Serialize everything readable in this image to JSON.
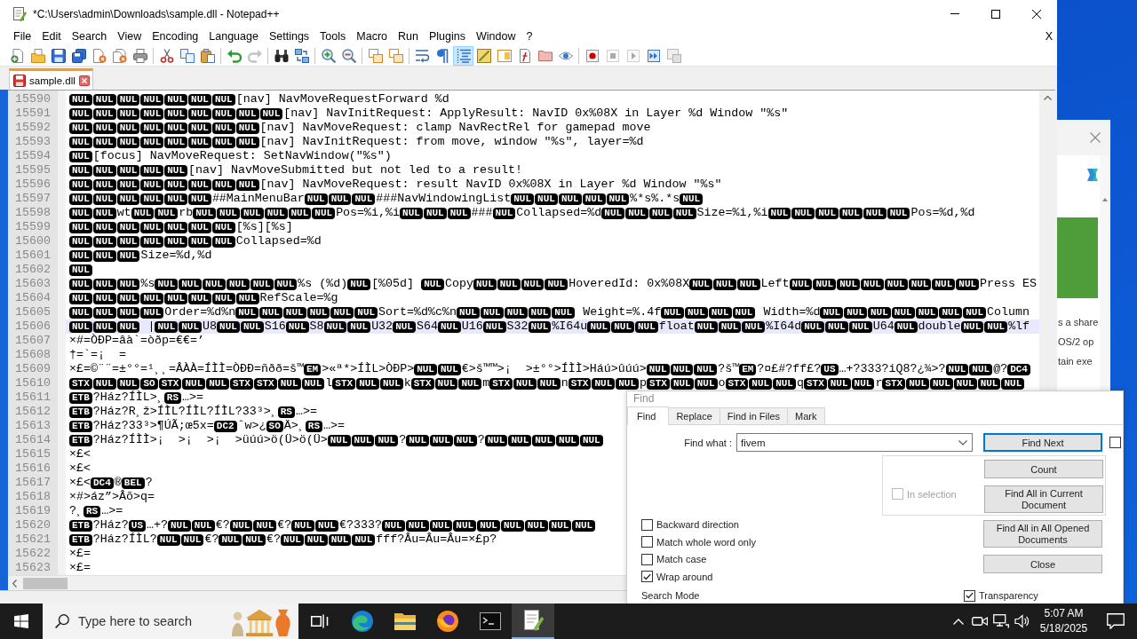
{
  "window": {
    "title": "*C:\\Users\\admin\\Downloads\\sample.dll - Notepad++"
  },
  "menu": {
    "items": [
      "File",
      "Edit",
      "Search",
      "View",
      "Encoding",
      "Language",
      "Settings",
      "Tools",
      "Macro",
      "Run",
      "Plugins",
      "Window",
      "?"
    ],
    "close_label": "X"
  },
  "toolbar": [
    [
      {
        "on": false,
        "disabled": false
      },
      {
        "on": false,
        "disabled": false
      },
      {
        "on": false,
        "disabled": false
      },
      {
        "on": false,
        "disabled": false
      },
      {
        "on": false,
        "disabled": false
      },
      {
        "on": false,
        "disabled": false
      },
      {
        "on": false,
        "disabled": false
      }
    ],
    [
      {
        "on": false,
        "disabled": false
      },
      {
        "on": false,
        "disabled": false
      },
      {
        "on": false,
        "disabled": false
      }
    ],
    [
      {
        "on": false,
        "disabled": false
      },
      {
        "on": false,
        "disabled": true
      }
    ],
    [
      {
        "on": false,
        "disabled": false
      },
      {
        "on": false,
        "disabled": false
      }
    ],
    [
      {
        "on": false,
        "disabled": false
      },
      {
        "on": false,
        "disabled": false
      }
    ],
    [
      {
        "on": false,
        "disabled": false
      },
      {
        "on": false,
        "disabled": false
      }
    ],
    [
      {
        "on": false,
        "disabled": false
      },
      {
        "on": false,
        "disabled": false
      },
      {
        "on": true,
        "disabled": false
      },
      {
        "on": false,
        "disabled": false
      },
      {
        "on": false,
        "disabled": false
      },
      {
        "on": false,
        "disabled": false
      },
      {
        "on": false,
        "disabled": false
      },
      {
        "on": false,
        "disabled": false
      }
    ],
    [
      {
        "on": false,
        "disabled": false
      },
      {
        "on": false,
        "disabled": true
      },
      {
        "on": false,
        "disabled": true
      },
      {
        "on": false,
        "disabled": false
      },
      {
        "on": false,
        "disabled": true
      }
    ]
  ],
  "tabs": [
    {
      "label": "sample.dll",
      "selected": true,
      "modified": true
    }
  ],
  "editor": {
    "lines": [
      {
        "number": "15590",
        "current": false,
        "parts": [
          {
            "kind": "ctrl",
            "codes": [
              "NUL",
              "NUL",
              "NUL",
              "NUL",
              "NUL",
              "NUL",
              "NUL"
            ]
          },
          {
            "kind": "text",
            "text": "[nav] NavMoveRequestForward %d"
          }
        ]
      },
      {
        "number": "15591",
        "current": false,
        "parts": [
          {
            "kind": "ctrl",
            "codes": [
              "NUL",
              "NUL",
              "NUL",
              "NUL",
              "NUL",
              "NUL",
              "NUL",
              "NUL",
              "NUL"
            ]
          },
          {
            "kind": "text",
            "text": "[nav] NavInitRequest: ApplyResult: NavID 0x%08X in Layer %d Window \"%s\""
          }
        ]
      },
      {
        "number": "15592",
        "current": false,
        "parts": [
          {
            "kind": "ctrl",
            "codes": [
              "NUL",
              "NUL",
              "NUL",
              "NUL",
              "NUL",
              "NUL",
              "NUL",
              "NUL"
            ]
          },
          {
            "kind": "text",
            "text": "[nav] NavMoveRequest: clamp NavRectRel for gamepad move"
          }
        ]
      },
      {
        "number": "15593",
        "current": false,
        "parts": [
          {
            "kind": "ctrl",
            "codes": [
              "NUL",
              "NUL",
              "NUL",
              "NUL",
              "NUL",
              "NUL",
              "NUL",
              "NUL"
            ]
          },
          {
            "kind": "text",
            "text": "[nav] NavInitRequest: from move, window \"%s\", layer=%d"
          }
        ]
      },
      {
        "number": "15594",
        "current": false,
        "parts": [
          {
            "kind": "ctrl",
            "codes": [
              "NUL"
            ]
          },
          {
            "kind": "text",
            "text": "[focus] NavMoveRequest: SetNavWindow(\"%s\")"
          }
        ]
      },
      {
        "number": "15595",
        "current": false,
        "parts": [
          {
            "kind": "ctrl",
            "codes": [
              "NUL",
              "NUL",
              "NUL",
              "NUL",
              "NUL"
            ]
          },
          {
            "kind": "text",
            "text": "[nav] NavMoveSubmitted but not led to a result!"
          }
        ]
      },
      {
        "number": "15596",
        "current": false,
        "parts": [
          {
            "kind": "ctrl",
            "codes": [
              "NUL",
              "NUL",
              "NUL",
              "NUL",
              "NUL",
              "NUL",
              "NUL",
              "NUL"
            ]
          },
          {
            "kind": "text",
            "text": "[nav] NavMoveRequest: result NavID 0x%08X in Layer %d Window \"%s\""
          }
        ]
      },
      {
        "number": "15597",
        "current": false,
        "parts": [
          {
            "kind": "ctrl",
            "codes": [
              "NUL",
              "NUL",
              "NUL",
              "NUL",
              "NUL",
              "NUL"
            ]
          },
          {
            "kind": "text",
            "text": "##MainMenuBar"
          },
          {
            "kind": "ctrl",
            "codes": [
              "NUL",
              "NUL",
              "NUL"
            ]
          },
          {
            "kind": "text",
            "text": "###NavWindowingList"
          },
          {
            "kind": "ctrl",
            "codes": [
              "NUL",
              "NUL",
              "NUL",
              "NUL",
              "NUL"
            ]
          },
          {
            "kind": "text",
            "text": "%*s%.*s"
          },
          {
            "kind": "ctrl",
            "codes": [
              "NUL"
            ]
          }
        ]
      },
      {
        "number": "15598",
        "current": false,
        "parts": [
          {
            "kind": "ctrl",
            "codes": [
              "NUL",
              "NUL"
            ]
          },
          {
            "kind": "text",
            "text": "wt"
          },
          {
            "kind": "ctrl",
            "codes": [
              "NUL",
              "NUL"
            ]
          },
          {
            "kind": "text",
            "text": "rb"
          },
          {
            "kind": "ctrl",
            "codes": [
              "NUL",
              "NUL",
              "NUL",
              "NUL",
              "NUL",
              "NUL"
            ]
          },
          {
            "kind": "text",
            "text": "Pos=%i,%i"
          },
          {
            "kind": "ctrl",
            "codes": [
              "NUL",
              "NUL",
              "NUL"
            ]
          },
          {
            "kind": "text",
            "text": "###"
          },
          {
            "kind": "ctrl",
            "codes": [
              "NUL"
            ]
          },
          {
            "kind": "text",
            "text": "Collapsed=%d"
          },
          {
            "kind": "ctrl",
            "codes": [
              "NUL",
              "NUL",
              "NUL",
              "NUL"
            ]
          },
          {
            "kind": "text",
            "text": "Size=%i,%i"
          },
          {
            "kind": "ctrl",
            "codes": [
              "NUL",
              "NUL",
              "NUL",
              "NUL",
              "NUL",
              "NUL"
            ]
          },
          {
            "kind": "text",
            "text": "Pos=%d,%d"
          }
        ]
      },
      {
        "number": "15599",
        "current": false,
        "parts": [
          {
            "kind": "ctrl",
            "codes": [
              "NUL",
              "NUL",
              "NUL",
              "NUL",
              "NUL",
              "NUL",
              "NUL"
            ]
          },
          {
            "kind": "text",
            "text": "[%s][%s]"
          }
        ]
      },
      {
        "number": "15600",
        "current": false,
        "parts": [
          {
            "kind": "ctrl",
            "codes": [
              "NUL",
              "NUL",
              "NUL",
              "NUL",
              "NUL",
              "NUL",
              "NUL"
            ]
          },
          {
            "kind": "text",
            "text": "Collapsed=%d"
          }
        ]
      },
      {
        "number": "15601",
        "current": false,
        "parts": [
          {
            "kind": "ctrl",
            "codes": [
              "NUL",
              "NUL",
              "NUL"
            ]
          },
          {
            "kind": "text",
            "text": "Size=%d,%d"
          }
        ]
      },
      {
        "number": "15602",
        "current": false,
        "parts": [
          {
            "kind": "ctrl",
            "codes": [
              "NUL"
            ]
          }
        ]
      },
      {
        "number": "15603",
        "current": false,
        "parts": [
          {
            "kind": "ctrl",
            "codes": [
              "NUL",
              "NUL",
              "NUL"
            ]
          },
          {
            "kind": "text",
            "text": "%s"
          },
          {
            "kind": "ctrl",
            "codes": [
              "NUL",
              "NUL",
              "NUL",
              "NUL",
              "NUL",
              "NUL"
            ]
          },
          {
            "kind": "text",
            "text": "%s (%d)"
          },
          {
            "kind": "ctrl",
            "codes": [
              "NUL"
            ]
          },
          {
            "kind": "text",
            "text": "[%05d] "
          },
          {
            "kind": "ctrl",
            "codes": [
              "NUL"
            ]
          },
          {
            "kind": "text",
            "text": "Copy"
          },
          {
            "kind": "ctrl",
            "codes": [
              "NUL",
              "NUL",
              "NUL",
              "NUL"
            ]
          },
          {
            "kind": "text",
            "text": "HoveredId: 0x%08X"
          },
          {
            "kind": "ctrl",
            "codes": [
              "NUL",
              "NUL",
              "NUL"
            ]
          },
          {
            "kind": "text",
            "text": "Left"
          },
          {
            "kind": "ctrl",
            "codes": [
              "NUL",
              "NUL",
              "NUL",
              "NUL",
              "NUL",
              "NUL",
              "NUL",
              "NUL"
            ]
          },
          {
            "kind": "text",
            "text": "Press ES"
          }
        ]
      },
      {
        "number": "15604",
        "current": false,
        "parts": [
          {
            "kind": "ctrl",
            "codes": [
              "NUL",
              "NUL",
              "NUL",
              "NUL",
              "NUL",
              "NUL",
              "NUL",
              "NUL"
            ]
          },
          {
            "kind": "text",
            "text": "RefScale=%g"
          }
        ]
      },
      {
        "number": "15605",
        "current": false,
        "parts": [
          {
            "kind": "ctrl",
            "codes": [
              "NUL",
              "NUL",
              "NUL",
              "NUL"
            ]
          },
          {
            "kind": "text",
            "text": "Order=%d%n"
          },
          {
            "kind": "ctrl",
            "codes": [
              "NUL",
              "NUL",
              "NUL",
              "NUL",
              "NUL",
              "NUL"
            ]
          },
          {
            "kind": "text",
            "text": "Sort=%d%c%n"
          },
          {
            "kind": "ctrl",
            "codes": [
              "NUL",
              "NUL",
              "NUL",
              "NUL",
              "NUL"
            ]
          },
          {
            "kind": "text",
            "text": " Weight=%.4f"
          },
          {
            "kind": "ctrl",
            "codes": [
              "NUL",
              "NUL",
              "NUL",
              "NUL"
            ]
          },
          {
            "kind": "text",
            "text": " Width=%d"
          },
          {
            "kind": "ctrl",
            "codes": [
              "NUL",
              "NUL",
              "NUL",
              "NUL",
              "NUL",
              "NUL",
              "NUL"
            ]
          },
          {
            "kind": "text",
            "text": "Column"
          }
        ]
      },
      {
        "number": "15606",
        "current": true,
        "parts": [
          {
            "kind": "ctrl",
            "codes": [
              "NUL",
              "NUL",
              "NUL"
            ]
          },
          {
            "kind": "text",
            "text": " |"
          },
          {
            "kind": "ctrl",
            "codes": [
              "NUL",
              "NUL"
            ]
          },
          {
            "kind": "text",
            "text": "U8"
          },
          {
            "kind": "ctrl",
            "codes": [
              "NUL",
              "NUL"
            ]
          },
          {
            "kind": "text",
            "text": "S16"
          },
          {
            "kind": "ctrl",
            "codes": [
              "NUL"
            ]
          },
          {
            "kind": "text",
            "text": "S8"
          },
          {
            "kind": "ctrl",
            "codes": [
              "NUL",
              "NUL"
            ]
          },
          {
            "kind": "text",
            "text": "U32"
          },
          {
            "kind": "ctrl",
            "codes": [
              "NUL"
            ]
          },
          {
            "kind": "text",
            "text": "S64"
          },
          {
            "kind": "ctrl",
            "codes": [
              "NUL"
            ]
          },
          {
            "kind": "text",
            "text": "U16"
          },
          {
            "kind": "ctrl",
            "codes": [
              "NUL"
            ]
          },
          {
            "kind": "text",
            "text": "S32"
          },
          {
            "kind": "ctrl",
            "codes": [
              "NUL"
            ]
          },
          {
            "kind": "text",
            "text": "%I64u"
          },
          {
            "kind": "ctrl",
            "codes": [
              "NUL",
              "NUL",
              "NUL"
            ]
          },
          {
            "kind": "text",
            "text": "float"
          },
          {
            "kind": "ctrl",
            "codes": [
              "NUL",
              "NUL",
              "NUL"
            ]
          },
          {
            "kind": "text",
            "text": "%I64d"
          },
          {
            "kind": "ctrl",
            "codes": [
              "NUL",
              "NUL",
              "NUL"
            ]
          },
          {
            "kind": "text",
            "text": "U64"
          },
          {
            "kind": "ctrl",
            "codes": [
              "NUL"
            ]
          },
          {
            "kind": "text",
            "text": "double"
          },
          {
            "kind": "ctrl",
            "codes": [
              "NUL",
              "NUL"
            ]
          },
          {
            "kind": "text",
            "text": "%lf"
          }
        ]
      },
      {
        "number": "15607",
        "current": false,
        "parts": [
          {
            "kind": "text",
            "text": "×#=ÒÐP=âà`=òðp=€€=’"
          }
        ]
      },
      {
        "number": "15608",
        "current": false,
        "parts": [
          {
            "kind": "text",
            "text": "†=`=¡  ="
          }
        ]
      },
      {
        "number": "15609",
        "current": false,
        "parts": [
          {
            "kind": "text",
            "text": "×£=©¨¨=±°°=¹¸¸=ÂÀÀ=ÍÌÌ=ÒÐÐ=ñðð=š™"
          },
          {
            "kind": "ctrl",
            "codes": [
              "EM"
            ]
          },
          {
            "kind": "text",
            "text": ">«ª*>ÍÌL>ÒÐP>"
          },
          {
            "kind": "ctrl",
            "codes": [
              "NUL",
              "NUL"
            ]
          },
          {
            "kind": "text",
            "text": "€>š™™>¡  >±°°>ÍÌÌ>Háú>ûúú>"
          },
          {
            "kind": "ctrl",
            "codes": [
              "NUL",
              "NUL",
              "NUL"
            ]
          },
          {
            "kind": "text",
            "text": "?š™"
          },
          {
            "kind": "ctrl",
            "codes": [
              "EM"
            ]
          },
          {
            "kind": "text",
            "text": "?¤£#?ff£?"
          },
          {
            "kind": "ctrl",
            "codes": [
              "US"
            ]
          },
          {
            "kind": "text",
            "text": "…+?333?iQ8?¿¾>?"
          },
          {
            "kind": "ctrl",
            "codes": [
              "NUL",
              "NUL"
            ]
          },
          {
            "kind": "text",
            "text": "@?"
          },
          {
            "kind": "ctrl",
            "codes": [
              "DC4"
            ]
          }
        ]
      },
      {
        "number": "15610",
        "current": false,
        "parts": [
          {
            "kind": "ctrl",
            "codes": [
              "STX",
              "NUL",
              "NUL",
              "SO",
              "STX",
              "NUL",
              "NUL",
              "STX",
              "STX",
              "NUL",
              "NUL"
            ]
          },
          {
            "kind": "text",
            "text": "l"
          },
          {
            "kind": "ctrl",
            "codes": [
              "STX",
              "NUL",
              "NUL"
            ]
          },
          {
            "kind": "text",
            "text": "k"
          },
          {
            "kind": "ctrl",
            "codes": [
              "STX",
              "NUL",
              "NUL"
            ]
          },
          {
            "kind": "text",
            "text": "m"
          },
          {
            "kind": "ctrl",
            "codes": [
              "STX",
              "NUL",
              "NUL"
            ]
          },
          {
            "kind": "text",
            "text": "n"
          },
          {
            "kind": "ctrl",
            "codes": [
              "STX",
              "NUL",
              "NUL"
            ]
          },
          {
            "kind": "text",
            "text": "p"
          },
          {
            "kind": "ctrl",
            "codes": [
              "STX",
              "NUL",
              "NUL"
            ]
          },
          {
            "kind": "text",
            "text": "o"
          },
          {
            "kind": "ctrl",
            "codes": [
              "STX",
              "NUL",
              "NUL"
            ]
          },
          {
            "kind": "text",
            "text": "q"
          },
          {
            "kind": "ctrl",
            "codes": [
              "STX",
              "NUL",
              "NUL"
            ]
          },
          {
            "kind": "text",
            "text": "r"
          },
          {
            "kind": "ctrl",
            "codes": [
              "STX",
              "NUL",
              "NUL",
              "NUL",
              "NUL",
              "NUL"
            ]
          }
        ]
      },
      {
        "number": "15611",
        "current": false,
        "parts": [
          {
            "kind": "ctrl",
            "codes": [
              "ETB"
            ]
          },
          {
            "kind": "text",
            "text": "?Ház?ÍÌL>¸"
          },
          {
            "kind": "ctrl",
            "codes": [
              "RS"
            ]
          },
          {
            "kind": "text",
            "text": "…>="
          }
        ]
      },
      {
        "number": "15612",
        "current": false,
        "parts": [
          {
            "kind": "ctrl",
            "codes": [
              "ETB"
            ]
          },
          {
            "kind": "text",
            "text": "?Ház?R¸ž>ÍÌL?ÍÌL?ÍÌL?33³>¸"
          },
          {
            "kind": "ctrl",
            "codes": [
              "RS"
            ]
          },
          {
            "kind": "text",
            "text": "…>="
          }
        ]
      },
      {
        "number": "15613",
        "current": false,
        "parts": [
          {
            "kind": "ctrl",
            "codes": [
              "ETB"
            ]
          },
          {
            "kind": "text",
            "text": "?Ház?33³>¶ÚÃ;œ5x="
          },
          {
            "kind": "ctrl",
            "codes": [
              "DC2"
            ]
          },
          {
            "kind": "text",
            "text": "ˆw>¿"
          },
          {
            "kind": "ctrl",
            "codes": [
              "SO"
            ]
          },
          {
            "kind": "text",
            "text": "Ä>¸"
          },
          {
            "kind": "ctrl",
            "codes": [
              "RS"
            ]
          },
          {
            "kind": "text",
            "text": "…>="
          }
        ]
      },
      {
        "number": "15614",
        "current": false,
        "parts": [
          {
            "kind": "ctrl",
            "codes": [
              "ETB"
            ]
          },
          {
            "kind": "text",
            "text": "?Ház?ÍÌÌ>¡  >¡  >¡  >üúú>ö(Ü>ö(Ü>"
          },
          {
            "kind": "ctrl",
            "codes": [
              "NUL",
              "NUL",
              "NUL"
            ]
          },
          {
            "kind": "text",
            "text": "?"
          },
          {
            "kind": "ctrl",
            "codes": [
              "NUL",
              "NUL",
              "NUL"
            ]
          },
          {
            "kind": "text",
            "text": "?"
          },
          {
            "kind": "ctrl",
            "codes": [
              "NUL",
              "NUL",
              "NUL",
              "NUL",
              "NUL"
            ]
          }
        ]
      },
      {
        "number": "15615",
        "current": false,
        "parts": [
          {
            "kind": "text",
            "text": "×£<"
          }
        ]
      },
      {
        "number": "15616",
        "current": false,
        "parts": [
          {
            "kind": "text",
            "text": "×£<"
          }
        ]
      },
      {
        "number": "15617",
        "current": false,
        "parts": [
          {
            "kind": "text",
            "text": "×£<"
          },
          {
            "kind": "ctrl",
            "codes": [
              "DC4"
            ]
          },
          {
            "kind": "text",
            "text": "®"
          },
          {
            "kind": "ctrl",
            "codes": [
              "BEL"
            ]
          },
          {
            "kind": "text",
            "text": "?"
          }
        ]
      },
      {
        "number": "15618",
        "current": false,
        "parts": [
          {
            "kind": "text",
            "text": "×#>áz”>Âõ>q="
          }
        ]
      },
      {
        "number": "15619",
        "current": false,
        "parts": [
          {
            "kind": "text",
            "text": "?¸"
          },
          {
            "kind": "ctrl",
            "codes": [
              "RS"
            ]
          },
          {
            "kind": "text",
            "text": "…>="
          }
        ]
      },
      {
        "number": "15620",
        "current": false,
        "parts": [
          {
            "kind": "ctrl",
            "codes": [
              "ETB"
            ]
          },
          {
            "kind": "text",
            "text": "?Ház?"
          },
          {
            "kind": "ctrl",
            "codes": [
              "US"
            ]
          },
          {
            "kind": "text",
            "text": "…+?"
          },
          {
            "kind": "ctrl",
            "codes": [
              "NUL",
              "NUL"
            ]
          },
          {
            "kind": "text",
            "text": "€?"
          },
          {
            "kind": "ctrl",
            "codes": [
              "NUL",
              "NUL"
            ]
          },
          {
            "kind": "text",
            "text": "€?"
          },
          {
            "kind": "ctrl",
            "codes": [
              "NUL",
              "NUL"
            ]
          },
          {
            "kind": "text",
            "text": "€?333?"
          },
          {
            "kind": "ctrl",
            "codes": [
              "NUL",
              "NUL",
              "NUL",
              "NUL",
              "NUL",
              "NUL",
              "NUL",
              "NUL",
              "NUL"
            ]
          }
        ]
      },
      {
        "number": "15621",
        "current": false,
        "parts": [
          {
            "kind": "ctrl",
            "codes": [
              "ETB"
            ]
          },
          {
            "kind": "text",
            "text": "?Ház?ÍÌL?"
          },
          {
            "kind": "ctrl",
            "codes": [
              "NUL",
              "NUL"
            ]
          },
          {
            "kind": "text",
            "text": "€?"
          },
          {
            "kind": "ctrl",
            "codes": [
              "NUL",
              "NUL"
            ]
          },
          {
            "kind": "text",
            "text": "€?"
          },
          {
            "kind": "ctrl",
            "codes": [
              "NUL",
              "NUL",
              "NUL",
              "NUL"
            ]
          },
          {
            "kind": "text",
            "text": "fff?Âu=Âu=Âu=×£p?"
          }
        ]
      },
      {
        "number": "15622",
        "current": false,
        "parts": [
          {
            "kind": "text",
            "text": "×£="
          }
        ]
      },
      {
        "number": "15623",
        "current": false,
        "parts": [
          {
            "kind": "text",
            "text": "×£="
          }
        ]
      }
    ]
  },
  "find_dialog": {
    "title": "Find",
    "tabs": [
      {
        "label": "Find",
        "selected": true
      },
      {
        "label": "Replace",
        "selected": false
      },
      {
        "label": "Find in Files",
        "selected": false
      },
      {
        "label": "Mark",
        "selected": false
      }
    ],
    "find_what": {
      "label": "Find what :",
      "value": "fivem"
    },
    "find_next": {
      "label": "Find Next",
      "focused": true
    },
    "side_option": {
      "checked": false
    },
    "in_selection": {
      "label": "In selection",
      "checked": false,
      "disabled": true
    },
    "count": {
      "label": "Count"
    },
    "find_all_current": {
      "label": "Find All in Current Document"
    },
    "find_all_opened": {
      "label": "Find All in All Opened Documents"
    },
    "close": {
      "label": "Close"
    },
    "options": [
      {
        "label": "Backward direction",
        "checked": false
      },
      {
        "label": "Match whole word only",
        "checked": false
      },
      {
        "label": "Match case",
        "checked": false
      },
      {
        "label": "Wrap around",
        "checked": true
      }
    ],
    "search_mode": {
      "label": "Search Mode"
    },
    "transparency": {
      "label": "Transparency",
      "checked": true
    }
  },
  "background_window": {
    "texts": [
      "s a share",
      "OS/2 op",
      "tain exe"
    ]
  },
  "taskbar": {
    "search_placeholder": "Type here to search",
    "apps": [
      {
        "selected": false
      },
      {
        "selected": false
      },
      {
        "selected": false
      },
      {
        "selected": false
      },
      {
        "selected": true
      }
    ],
    "time": "5:07 AM",
    "date": "5/18/2025"
  }
}
